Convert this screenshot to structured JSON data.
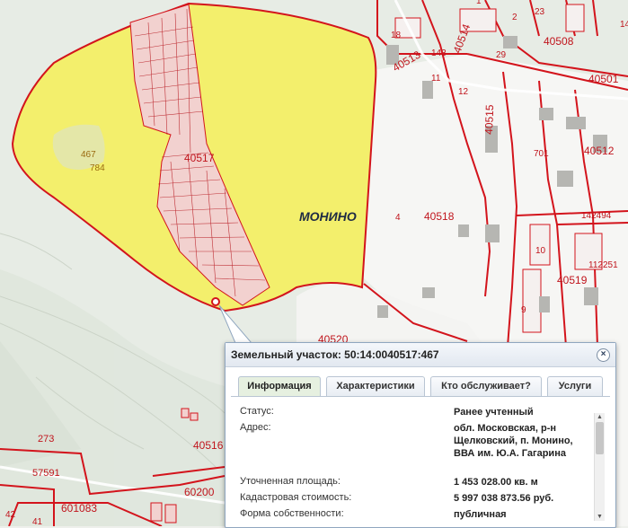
{
  "map": {
    "locality_label": "МОНИНО",
    "parcel_labels": [
      "40517",
      "40518",
      "40515",
      "40512",
      "40513",
      "40514",
      "40508",
      "40501",
      "40519",
      "40520",
      "40516",
      "142494",
      "112251",
      "701",
      "9",
      "10",
      "4",
      "467",
      "784",
      "273",
      "57591",
      "601083",
      "60200",
      "42",
      "41",
      "18",
      "12",
      "11",
      "14",
      "23",
      "29",
      "143",
      "1",
      "2"
    ],
    "colors": {
      "highlight": "#f3ef6c",
      "boundary": "#d3141c",
      "white_area": "#ffffff",
      "terrain": "#e6ebe4"
    }
  },
  "popup": {
    "title": "Земельный участок: 50:14:0040517:467",
    "close_icon": "close-icon",
    "tabs": [
      {
        "label": "Информация",
        "active": true
      },
      {
        "label": "Характеристики",
        "active": false
      },
      {
        "label": "Кто обслуживает?",
        "active": false
      },
      {
        "label": "Услуги",
        "active": false
      }
    ],
    "rows": [
      {
        "label": "Статус:",
        "value": "Ранее учтенный"
      },
      {
        "label": "Адрес:",
        "value_lines": [
          "обл. Московская, р-н",
          "Щелковский, п. Монино,",
          "ВВА им. Ю.А. Гагарина"
        ]
      },
      {
        "label": "Уточненная площадь:",
        "value": "1 453 028.00 кв. м"
      },
      {
        "label": "Кадастровая стоимость:",
        "value": "5 997 038 873.56 руб."
      },
      {
        "label": "Форма собственности:",
        "value": "публичная"
      }
    ]
  }
}
